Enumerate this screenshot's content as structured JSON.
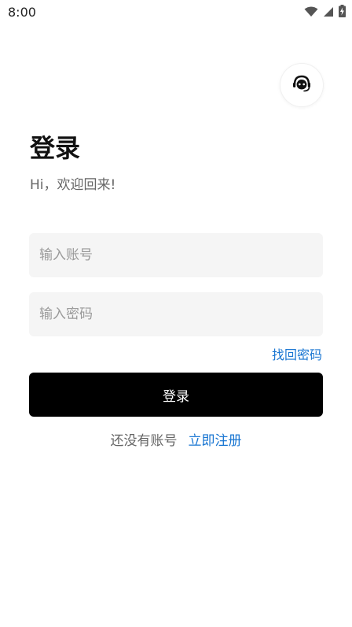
{
  "status_bar": {
    "time": "8:00",
    "icons": [
      "wifi-icon",
      "signal-icon",
      "battery-charging-icon"
    ]
  },
  "support": {
    "icon": "customer-service-headset-icon"
  },
  "login": {
    "title": "登录",
    "subtitle": "Hi，欢迎回来!",
    "account_placeholder": "输入账号",
    "account_value": "",
    "password_placeholder": "输入密码",
    "password_value": "",
    "forgot_password": "找回密码",
    "login_button": "登录",
    "no_account_text": "还没有账号",
    "register_link": "立即注册"
  },
  "colors": {
    "accent_link": "#1976d2",
    "primary_button": "#000000",
    "input_background": "#f5f5f5"
  }
}
